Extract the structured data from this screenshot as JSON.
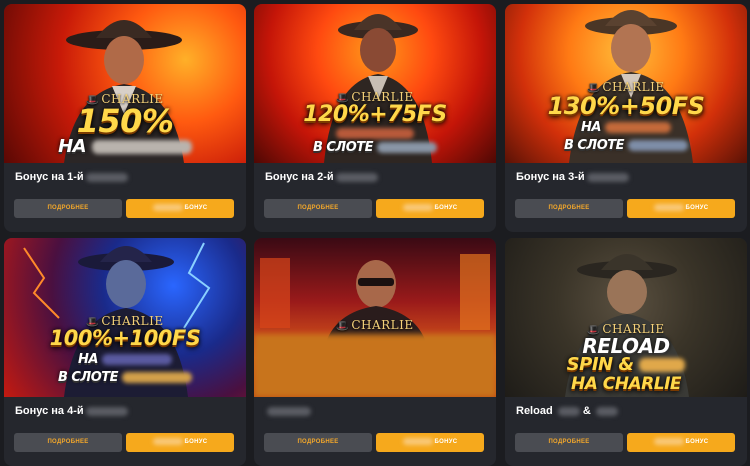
{
  "colors": {
    "page_bg": "#1b1c20",
    "card_bg": "#25272d",
    "more_button_bg": "#4a4c52",
    "more_button_text": "#f4a82a",
    "bonus_button_bg": "#f6a91c",
    "promo_yellow": "#ffd84a"
  },
  "logo_text": "CHARLIE",
  "buttons": {
    "more_label": "ПОДРОБНЕЕ",
    "bonus_label": "БОНУС"
  },
  "cards": [
    {
      "title": "Бонус на 1-й",
      "promo_main": "150%",
      "promo_line2": "НА",
      "promo_line3": ""
    },
    {
      "title": "Бонус на 2-й",
      "promo_main": "120%+75FS",
      "promo_line2": "",
      "promo_line3": "В СЛОТЕ"
    },
    {
      "title": "Бонус на 3-й",
      "promo_main": "130%+50FS",
      "promo_line2": "НА",
      "promo_line3": "В СЛОТЕ"
    },
    {
      "title": "Бонус на 4-й",
      "promo_main": "100%+100FS",
      "promo_line2": "НА",
      "promo_line3": "В СЛОТЕ"
    },
    {
      "title": "",
      "promo_main": "",
      "promo_line2": "",
      "promo_line3": ""
    },
    {
      "title": "Reload",
      "title_extra": "&",
      "promo_main": "RELOAD",
      "promo_line2": "SPIN &",
      "promo_line3": "НА CHARLIE"
    }
  ]
}
